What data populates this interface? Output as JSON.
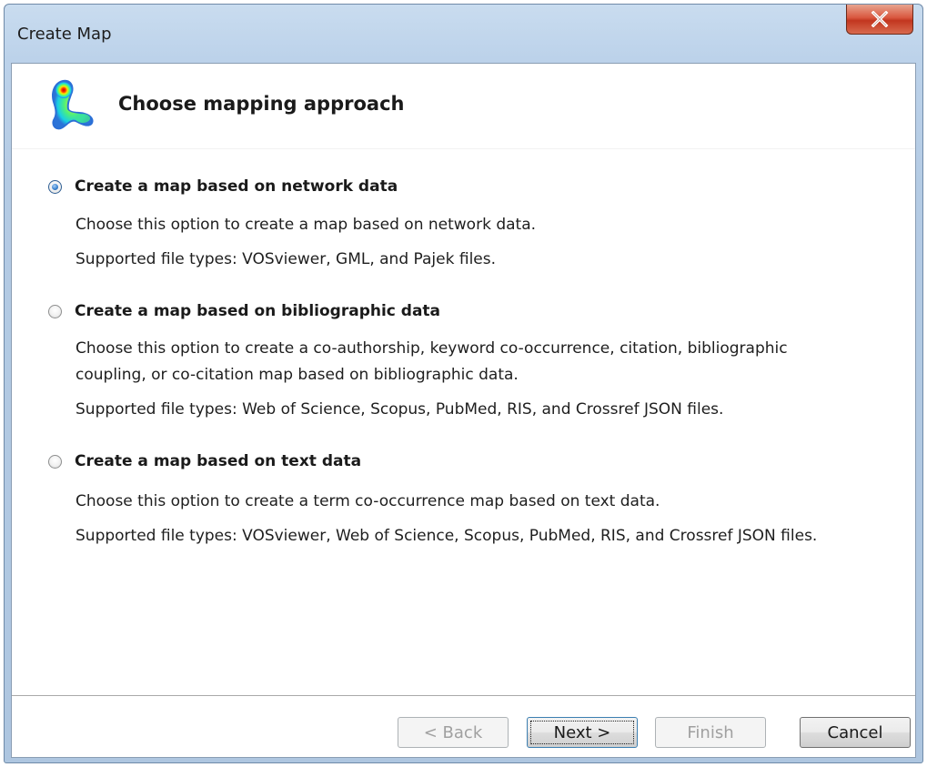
{
  "window": {
    "title": "Create Map",
    "close_label": "X"
  },
  "header": {
    "title": "Choose mapping approach",
    "logo_icon": "vosviewer-density-logo"
  },
  "options": [
    {
      "label": "Create a map based on network data",
      "checked": true,
      "descriptions": [
        "Choose this option to create a map based on network data.",
        "Supported file types: VOSviewer, GML, and Pajek files."
      ]
    },
    {
      "label": "Create a map based on bibliographic data",
      "checked": false,
      "descriptions": [
        "Choose this option to create a co-authorship, keyword co-occurrence, citation, bibliographic",
        "coupling, or co-citation map based on bibliographic data.",
        "Supported file types: Web of Science, Scopus, PubMed, RIS, and Crossref JSON files."
      ]
    },
    {
      "label": "Create a map based on text data",
      "checked": false,
      "descriptions": [
        "Choose this option to create a term co-occurrence map based on text data.",
        "Supported file types: VOSviewer, Web of Science, Scopus, PubMed, RIS, and Crossref JSON files."
      ]
    }
  ],
  "buttons": {
    "back": {
      "label": "< Back",
      "enabled": false
    },
    "next": {
      "label": "Next >",
      "enabled": true,
      "default": true
    },
    "finish": {
      "label": "Finish",
      "enabled": false
    },
    "cancel": {
      "label": "Cancel",
      "enabled": true
    }
  },
  "colors": {
    "close_button": "#c9432a",
    "radio_selected": "#3f86d1",
    "disabled_text": "#a0a0a0"
  }
}
